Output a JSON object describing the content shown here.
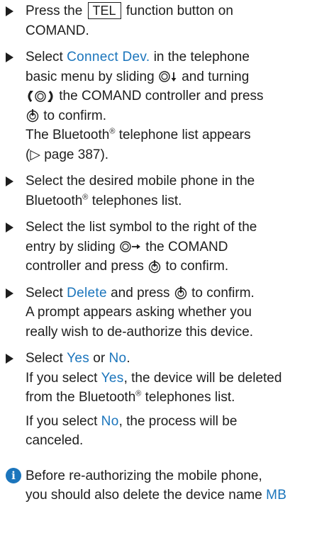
{
  "step1": {
    "pre": "Press the",
    "key": "TEL",
    "post": "function button on",
    "line2": "COMAND."
  },
  "step2": {
    "pre": "Select",
    "menu": "Connect Dev.",
    "post": "in the telephone",
    "line2a": "basic menu by sliding",
    "line2b": "and turning",
    "line3": "the COMAND controller and press",
    "line4": "to confirm.",
    "line5a": "The Bluetooth",
    "reg": "®",
    "line5b": "telephone list appears",
    "line6": "(▷ page 387)."
  },
  "step3": {
    "line1": "Select the desired mobile phone in the",
    "line2a": "Bluetooth",
    "reg": "®",
    "line2b": "telephones list."
  },
  "step4": {
    "line1": "Select the list symbol to the right of the",
    "line2a": "entry by sliding",
    "line2b": "the COMAND",
    "line3a": "controller and press",
    "line3b": "to confirm."
  },
  "step5": {
    "pre": "Select",
    "menu": "Delete",
    "post": "and press",
    "post2": "to confirm.",
    "line2": "A prompt appears asking whether you",
    "line3": "really wish to de-authorize this device."
  },
  "step6": {
    "pre": "Select",
    "yes": "Yes",
    "or": "or",
    "no": "No",
    "end": ".",
    "line2a": "If you select",
    "line2b": ", the device will be deleted",
    "line3a": "from the Bluetooth",
    "reg": "®",
    "line3b": "telephones list.",
    "line4a": "If you select",
    "line4b": ", the process will be",
    "line5": "canceled."
  },
  "note": {
    "icon": "i",
    "line1": "Before re-authorizing the mobile phone,",
    "line2a": "you should also delete the device name",
    "mb": "MB"
  },
  "colors": {
    "accent": "#1b75bc",
    "text": "#1e1e1e"
  },
  "icons": [
    "bullet-triangle-icon",
    "slide-down-icon",
    "turn-controller-icon",
    "press-controller-icon",
    "slide-right-icon",
    "info-icon"
  ]
}
